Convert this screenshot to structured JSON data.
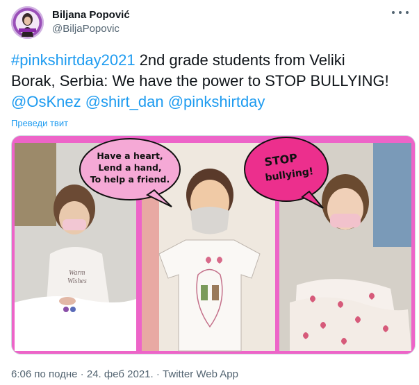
{
  "author": {
    "name": "Biljana Popović",
    "handle": "@BiljaPopovic"
  },
  "tweet": {
    "hashtag": "#pinkshirtday2021",
    "text_line1": " 2nd grade students from Veliki",
    "text_line2": "Borak, Serbia: We have the power to STOP BULLYING!",
    "mention1": "@OsKnez",
    "mention2": "@shirt_dan",
    "mention3": "@pinkshirtday",
    "translate_label": "Преведи твит"
  },
  "media": {
    "bubble_left_line1": "Have a heart,",
    "bubble_left_line2": "Lend a hand,",
    "bubble_left_line3": "To help a friend.",
    "bubble_right_line1": "STOP",
    "bubble_right_line2": "bullying!",
    "shirt_text_line1": "Warm",
    "shirt_text_line2": "Wishes"
  },
  "meta": {
    "time": "6:06 по подне",
    "separator": " · ",
    "date": "24. феб 2021.",
    "source": "Twitter Web App"
  },
  "colors": {
    "link": "#1d9bf0",
    "frame_pink": "#ed64c8",
    "bubble_pink": "#f5a9d6",
    "bubble_magenta": "#ec2f8d"
  },
  "icons": [
    "more-options-icon"
  ]
}
